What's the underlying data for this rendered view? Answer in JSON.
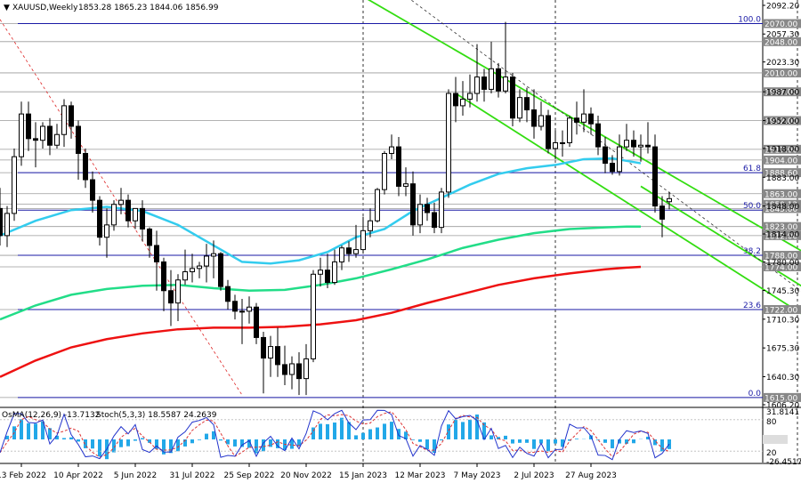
{
  "header": {
    "symbol": "XAUUSD,Weekly",
    "ohlc": "1853.28 1865.23 1844.06 1856.99"
  },
  "indicator": {
    "osma_label": "OsMA(12,26,9) -13.7132",
    "stoch_label": "Stoch(5,3,3) 18.5587 24.2639",
    "axis_labels": [
      "31.8141",
      "80",
      "0.00",
      "20",
      "-26.4517"
    ]
  },
  "colors": {
    "bull": "#ffffff",
    "bear": "#000000",
    "ma_fast": "#33ccee",
    "ma_mid": "#22dd88",
    "ma_slow": "#ee1111",
    "channel": "#33dd11",
    "fib": "#1a1aa6",
    "osma": "#22a8e8",
    "stoch_main": "#2233cc",
    "stoch_signal": "#dd3333"
  },
  "chart_data": {
    "type": "candlestick",
    "title": "XAUUSD,Weekly",
    "ylim": [
      1606.2,
      2092.2
    ],
    "y_ticks": [
      2092.2,
      2057.3,
      2023.3,
      1987.0,
      1952.0,
      1918.0,
      1883.0,
      1848.0,
      1814.0,
      1780.0,
      1745.3,
      1710.3,
      1675.3,
      1640.3,
      1606.2
    ],
    "x_labels": [
      "13 Feb 2022",
      "10 Apr 2022",
      "5 Jun 2022",
      "31 Jul 2022",
      "25 Sep 2022",
      "20 Nov 2022",
      "15 Jan 2023",
      "12 Mar 2023",
      "7 May 2023",
      "2 Jul 2023",
      "27 Aug 2023"
    ],
    "x_label_index": [
      3,
      11,
      19,
      27,
      35,
      43,
      51,
      59,
      67,
      75,
      83
    ],
    "candles": [
      [
        1845,
        1870,
        1800,
        1812
      ],
      [
        1812,
        1848,
        1798,
        1839
      ],
      [
        1839,
        1918,
        1830,
        1908
      ],
      [
        1908,
        1975,
        1897,
        1960
      ],
      [
        1960,
        1975,
        1915,
        1930
      ],
      [
        1930,
        1950,
        1895,
        1928
      ],
      [
        1928,
        1950,
        1918,
        1945
      ],
      [
        1945,
        1955,
        1910,
        1922
      ],
      [
        1922,
        1948,
        1918,
        1935
      ],
      [
        1935,
        1978,
        1920,
        1970
      ],
      [
        1970,
        1975,
        1930,
        1945
      ],
      [
        1945,
        1952,
        1880,
        1912
      ],
      [
        1912,
        1918,
        1870,
        1880
      ],
      [
        1880,
        1890,
        1840,
        1855
      ],
      [
        1855,
        1860,
        1800,
        1810
      ],
      [
        1810,
        1845,
        1785,
        1825
      ],
      [
        1825,
        1855,
        1818,
        1850
      ],
      [
        1850,
        1870,
        1838,
        1855
      ],
      [
        1855,
        1862,
        1822,
        1830
      ],
      [
        1830,
        1845,
        1820,
        1845
      ],
      [
        1845,
        1855,
        1805,
        1820
      ],
      [
        1820,
        1822,
        1785,
        1800
      ],
      [
        1800,
        1818,
        1745,
        1780
      ],
      [
        1780,
        1785,
        1720,
        1745
      ],
      [
        1745,
        1770,
        1702,
        1730
      ],
      [
        1730,
        1765,
        1708,
        1758
      ],
      [
        1758,
        1795,
        1752,
        1768
      ],
      [
        1768,
        1790,
        1755,
        1772
      ],
      [
        1772,
        1780,
        1760,
        1775
      ],
      [
        1775,
        1802,
        1755,
        1787
      ],
      [
        1787,
        1806,
        1760,
        1790
      ],
      [
        1790,
        1792,
        1745,
        1750
      ],
      [
        1750,
        1758,
        1722,
        1732
      ],
      [
        1732,
        1740,
        1710,
        1720
      ],
      [
        1720,
        1735,
        1680,
        1720
      ],
      [
        1720,
        1738,
        1705,
        1725
      ],
      [
        1725,
        1730,
        1680,
        1688
      ],
      [
        1688,
        1695,
        1620,
        1663
      ],
      [
        1663,
        1690,
        1640,
        1677
      ],
      [
        1677,
        1700,
        1640,
        1655
      ],
      [
        1655,
        1678,
        1630,
        1643
      ],
      [
        1643,
        1665,
        1625,
        1656
      ],
      [
        1656,
        1670,
        1618,
        1638
      ],
      [
        1638,
        1680,
        1618,
        1662
      ],
      [
        1662,
        1770,
        1658,
        1765
      ],
      [
        1765,
        1785,
        1750,
        1770
      ],
      [
        1770,
        1790,
        1748,
        1755
      ],
      [
        1755,
        1795,
        1752,
        1780
      ],
      [
        1780,
        1800,
        1770,
        1797
      ],
      [
        1797,
        1805,
        1780,
        1790
      ],
      [
        1790,
        1825,
        1785,
        1795
      ],
      [
        1795,
        1835,
        1790,
        1818
      ],
      [
        1818,
        1845,
        1810,
        1830
      ],
      [
        1830,
        1870,
        1828,
        1868
      ],
      [
        1868,
        1915,
        1862,
        1912
      ],
      [
        1912,
        1935,
        1905,
        1920
      ],
      [
        1920,
        1932,
        1860,
        1872
      ],
      [
        1872,
        1895,
        1860,
        1875
      ],
      [
        1875,
        1890,
        1812,
        1825
      ],
      [
        1825,
        1862,
        1815,
        1850
      ],
      [
        1850,
        1858,
        1830,
        1840
      ],
      [
        1840,
        1852,
        1815,
        1822
      ],
      [
        1822,
        1870,
        1815,
        1865
      ],
      [
        1865,
        1990,
        1858,
        1985
      ],
      [
        1985,
        2005,
        1950,
        1970
      ],
      [
        1970,
        2000,
        1958,
        1978
      ],
      [
        1978,
        2008,
        1968,
        1985
      ],
      [
        1985,
        2045,
        1975,
        2005
      ],
      [
        2005,
        2015,
        1975,
        1990
      ],
      [
        1990,
        2048,
        1985,
        2015
      ],
      [
        2015,
        2022,
        1980,
        1988
      ],
      [
        1988,
        2072,
        1985,
        2005
      ],
      [
        2005,
        2010,
        1945,
        1955
      ],
      [
        1955,
        1990,
        1950,
        1980
      ],
      [
        1980,
        1992,
        1950,
        1965
      ],
      [
        1965,
        1990,
        1930,
        1945
      ],
      [
        1945,
        1975,
        1940,
        1958
      ],
      [
        1958,
        1965,
        1912,
        1918
      ],
      [
        1918,
        1940,
        1905,
        1925
      ],
      [
        1925,
        1940,
        1908,
        1925
      ],
      [
        1925,
        1958,
        1920,
        1955
      ],
      [
        1955,
        1975,
        1935,
        1950
      ],
      [
        1950,
        1990,
        1938,
        1960
      ],
      [
        1960,
        1968,
        1935,
        1948
      ],
      [
        1948,
        1958,
        1910,
        1920
      ],
      [
        1920,
        1932,
        1888,
        1900
      ],
      [
        1900,
        1910,
        1886,
        1890
      ],
      [
        1890,
        1935,
        1885,
        1920
      ],
      [
        1920,
        1948,
        1915,
        1928
      ],
      [
        1928,
        1940,
        1908,
        1920
      ],
      [
        1920,
        1935,
        1902,
        1922
      ],
      [
        1922,
        1950,
        1912,
        1920
      ],
      [
        1920,
        1935,
        1840,
        1848
      ],
      [
        1848,
        1860,
        1810,
        1832
      ],
      [
        1853.28,
        1865.23,
        1844.06,
        1856.99
      ]
    ],
    "price_levels": [
      {
        "value": 2070.0,
        "label": "2070.00"
      },
      {
        "value": 2048.0,
        "label": "2048.00"
      },
      {
        "value": 2010.0,
        "label": "2010.00"
      },
      {
        "value": 1987.0,
        "label": "1987.00"
      },
      {
        "value": 1952.0,
        "label": "1952.00"
      },
      {
        "value": 1917.0,
        "label": "1917.00"
      },
      {
        "value": 1904.0,
        "label": "1904.00"
      },
      {
        "value": 1888.6,
        "label": "1888.60"
      },
      {
        "value": 1863.0,
        "label": "1863.00"
      },
      {
        "value": 1850.12,
        "label": "1850.12"
      },
      {
        "value": 1845.0,
        "label": "1845.00"
      },
      {
        "value": 1823.0,
        "label": "1823.00"
      },
      {
        "value": 1812.0,
        "label": "1812.00"
      },
      {
        "value": 1788.0,
        "label": "1788.00"
      },
      {
        "value": 1774.0,
        "label": "1774.00"
      },
      {
        "value": 1722.0,
        "label": "1722.00"
      },
      {
        "value": 1615.0,
        "label": "1615.00"
      }
    ],
    "fib_levels": [
      {
        "value": 2070.0,
        "label": "100.0"
      },
      {
        "value": 1888.6,
        "label": "61.8"
      },
      {
        "value": 1843.0,
        "label": "50.0"
      },
      {
        "value": 1788.0,
        "label": "38.2"
      },
      {
        "value": 1722.0,
        "label": "23.6"
      },
      {
        "value": 1615.0,
        "label": "0.0"
      }
    ],
    "ma_fast": [
      [
        0,
        1812
      ],
      [
        5,
        1830
      ],
      [
        10,
        1843
      ],
      [
        15,
        1847
      ],
      [
        20,
        1842
      ],
      [
        25,
        1825
      ],
      [
        30,
        1800
      ],
      [
        34,
        1780
      ],
      [
        38,
        1778
      ],
      [
        42,
        1782
      ],
      [
        46,
        1792
      ],
      [
        50,
        1810
      ],
      [
        54,
        1820
      ],
      [
        58,
        1842
      ],
      [
        62,
        1858
      ],
      [
        66,
        1874
      ],
      [
        70,
        1887
      ],
      [
        74,
        1894
      ],
      [
        78,
        1898
      ],
      [
        82,
        1905
      ],
      [
        86,
        1906
      ],
      [
        88,
        1903
      ],
      [
        90,
        1900
      ]
    ],
    "ma_mid": [
      [
        0,
        1710
      ],
      [
        5,
        1727
      ],
      [
        10,
        1740
      ],
      [
        15,
        1747
      ],
      [
        20,
        1751
      ],
      [
        25,
        1752
      ],
      [
        30,
        1748
      ],
      [
        35,
        1745
      ],
      [
        40,
        1746
      ],
      [
        45,
        1752
      ],
      [
        50,
        1760
      ],
      [
        55,
        1771
      ],
      [
        60,
        1783
      ],
      [
        65,
        1797
      ],
      [
        70,
        1807
      ],
      [
        75,
        1815
      ],
      [
        80,
        1820
      ],
      [
        85,
        1822
      ],
      [
        88,
        1823
      ],
      [
        90,
        1823
      ]
    ],
    "ma_slow": [
      [
        0,
        1640
      ],
      [
        5,
        1660
      ],
      [
        10,
        1676
      ],
      [
        15,
        1686
      ],
      [
        20,
        1693
      ],
      [
        25,
        1698
      ],
      [
        30,
        1700
      ],
      [
        35,
        1700
      ],
      [
        40,
        1701
      ],
      [
        45,
        1704
      ],
      [
        50,
        1709
      ],
      [
        55,
        1718
      ],
      [
        60,
        1730
      ],
      [
        65,
        1741
      ],
      [
        70,
        1752
      ],
      [
        75,
        1760
      ],
      [
        80,
        1766
      ],
      [
        85,
        1771
      ],
      [
        88,
        1773
      ],
      [
        90,
        1774
      ]
    ],
    "channel": [
      {
        "from": [
          46,
          2128
        ],
        "to": [
          122,
          1746
        ]
      },
      {
        "from": [
          64,
          1985
        ],
        "to": [
          122,
          1665
        ]
      },
      {
        "from": [
          90,
          1872
        ],
        "to": [
          122,
          1700
        ]
      }
    ],
    "dashed_trend": [
      {
        "from": [
          0,
          2075
        ],
        "to": [
          34,
          1618
        ]
      },
      {
        "from": [
          56,
          2110
        ],
        "to": [
          121,
          1690
        ]
      }
    ],
    "dashed_vlines": [
      51,
      78,
      112
    ]
  }
}
